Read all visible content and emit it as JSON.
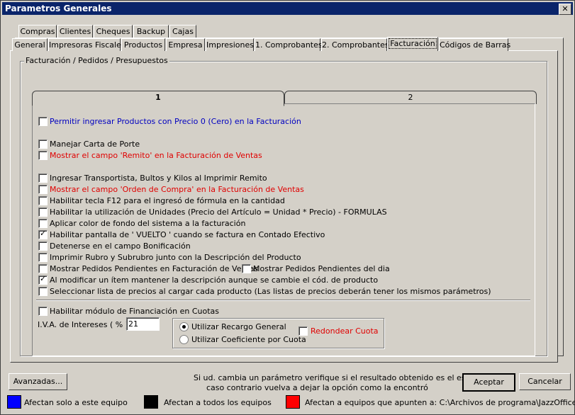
{
  "window": {
    "title": "Parametros Generales",
    "close": "✕"
  },
  "tabs_row1": [
    "Compras",
    "Clientes",
    "Cheques",
    "Backup",
    "Cajas"
  ],
  "tabs_row2": [
    "General",
    "Impresoras Fiscales",
    "Productos",
    "Empresa",
    "Impresiones",
    "1. Comprobantes",
    "2. Comprobantes",
    "Facturación",
    "Códigos de Barras"
  ],
  "active_tab": "Facturación",
  "group": {
    "label": "Facturación / Pedidos / Presupuestos"
  },
  "subtabs": [
    "1",
    "2"
  ],
  "options": {
    "o1": {
      "label": "Permitir ingresar Productos con Precio 0 (Cero) en la Facturación",
      "checked": false,
      "color": "#0000c0"
    },
    "o2": {
      "label": "Manejar Carta de Porte",
      "checked": false
    },
    "o3": {
      "label": "Mostrar el campo 'Remito' en la Facturación de Ventas",
      "checked": false,
      "color": "#e00000"
    },
    "o4": {
      "label": "Ingresar Transportista, Bultos y Kilos al Imprimir Remito",
      "checked": false
    },
    "o5": {
      "label": "Mostrar el campo 'Orden de Compra' en la Facturación de Ventas",
      "checked": false,
      "color": "#e00000"
    },
    "o6": {
      "label": "Habilitar tecla F12 para el ingresó de fórmula en la cantidad",
      "checked": false
    },
    "o7": {
      "label": "Habilitar la utilización de Unidades (Precio del Artículo = Unidad * Precio) - FORMULAS",
      "checked": false
    },
    "o8": {
      "label": "Aplicar color de fondo del sistema a la facturación",
      "checked": false
    },
    "o9": {
      "label": "Habilitar pantalla de ' VUELTO ' cuando se factura en Contado Efectivo",
      "checked": true
    },
    "o10": {
      "label": "Detenerse en el campo Bonificación",
      "checked": false
    },
    "o11": {
      "label": "Imprimir Rubro y Subrubro junto con la Descripción del Producto",
      "checked": false
    },
    "o12": {
      "label": "Mostrar Pedidos Pendientes en Facturación de Ventas",
      "checked": false
    },
    "o12b": {
      "label": "Mostrar Pedidos Pendientes del dia",
      "checked": false
    },
    "o13": {
      "label": "Al modificar un ítem mantener la descripción aunque se cambie el cód. de producto",
      "checked": true
    },
    "o14": {
      "label": "Seleccionar lista de precios al cargar cada producto (Las listas de precios deberán tener los mismos parámetros)",
      "checked": false
    },
    "o15": {
      "label": "Habilitar módulo de Financiación en Cuotas",
      "checked": false
    }
  },
  "iva": {
    "label": "I.V.A. de Intereses  ( % ) :",
    "value": "21"
  },
  "radios": {
    "r1": "Utilizar Recargo General",
    "r2": "Utilizar Coeficiente por Cuota",
    "selected": "r1"
  },
  "redondear": {
    "label": "Redondear Cuota",
    "checked": false
  },
  "footer": {
    "advanced": "Avanzadas...",
    "info1": "Si ud. cambia un parámetro verifique si el resultado obtenido es el esperado,",
    "info2": "caso contrario vuelva a dejar la opción como la encontró",
    "accept": "Aceptar",
    "cancel": "Cancelar"
  },
  "legend": {
    "blue": {
      "color": "#0000ff",
      "label": "Afectan solo a este equipo"
    },
    "black": {
      "color": "#000000",
      "label": "Afectan a todos los equipos"
    },
    "red": {
      "color": "#ff0000",
      "label": "Afectan a equipos que apunten a: C:\\Archivos de programa\\JazzOffice"
    }
  }
}
